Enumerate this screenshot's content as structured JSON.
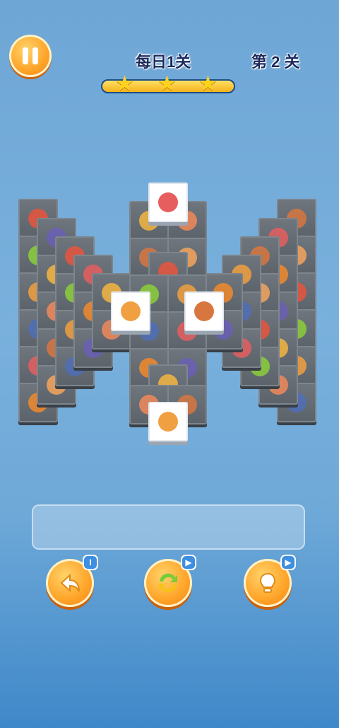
{
  "header": {
    "daily_title": "每日1关",
    "level_label": "第 2 关",
    "stars": 3,
    "progress": 1.0
  },
  "board": {
    "back_tiles": [
      "cola",
      "lemon",
      "donut",
      "blueberry",
      "meat",
      "chili",
      "eggplant",
      "fish",
      "steak",
      "bread",
      "chicken"
    ],
    "selectable_tiles": [
      "steak-icon",
      "drumstick-icon",
      "sandwich-icon",
      "drumstick-icon"
    ]
  },
  "tools": {
    "undo_badge": "I",
    "shuffle_badge": "▶",
    "hint_badge": "▶"
  },
  "colors": {
    "button_orange": "#ffa52a",
    "tile_face": "#ffffff",
    "tile_shadow": "#5b626a"
  }
}
